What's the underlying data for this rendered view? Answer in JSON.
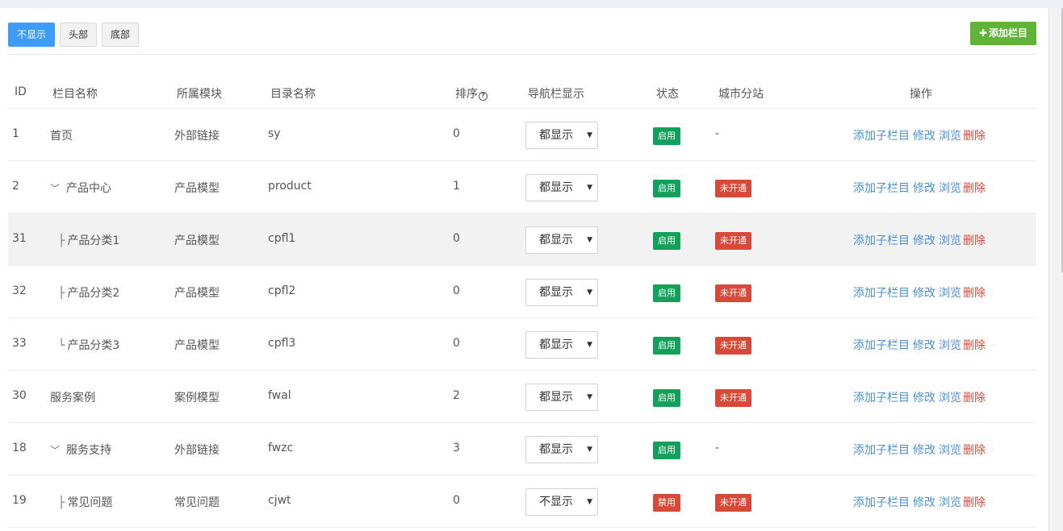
{
  "toolbar": {
    "tabs": [
      {
        "label": "不显示",
        "active": true
      },
      {
        "label": "头部",
        "active": false
      },
      {
        "label": "底部",
        "active": false
      }
    ],
    "add_label": "添加栏目"
  },
  "table": {
    "headers": {
      "id": "ID",
      "name": "栏目名称",
      "module": "所属模块",
      "dir": "目录名称",
      "sort": "排序",
      "nav": "导航栏显示",
      "status": "状态",
      "city": "城市分站",
      "ops": "操作"
    },
    "ops": {
      "add_child": "添加子栏目",
      "edit": "修改",
      "view": "浏览",
      "delete": "删除"
    },
    "rows": [
      {
        "id": "1",
        "name": "首页",
        "level": 0,
        "expandable": false,
        "tree": "",
        "module": "外部链接",
        "dir": "sy",
        "sort": "0",
        "nav": "都显示",
        "status": "启用",
        "status_color": "#13a05b",
        "city": "-"
      },
      {
        "id": "2",
        "name": "产品中心",
        "level": 0,
        "expandable": true,
        "tree": "",
        "module": "产品模型",
        "dir": "product",
        "sort": "1",
        "nav": "都显示",
        "status": "启用",
        "status_color": "#13a05b",
        "city": "未开通"
      },
      {
        "id": "31",
        "name": "产品分类1",
        "level": 1,
        "expandable": false,
        "tree": "├",
        "module": "产品模型",
        "dir": "cpfl1",
        "sort": "0",
        "nav": "都显示",
        "status": "启用",
        "status_color": "#13a05b",
        "city": "未开通"
      },
      {
        "id": "32",
        "name": "产品分类2",
        "level": 1,
        "expandable": false,
        "tree": "├",
        "module": "产品模型",
        "dir": "cpfl2",
        "sort": "0",
        "nav": "都显示",
        "status": "启用",
        "status_color": "#13a05b",
        "city": "未开通"
      },
      {
        "id": "33",
        "name": "产品分类3",
        "level": 1,
        "expandable": false,
        "tree": "└",
        "module": "产品模型",
        "dir": "cpfl3",
        "sort": "0",
        "nav": "都显示",
        "status": "启用",
        "status_color": "#13a05b",
        "city": "未开通"
      },
      {
        "id": "30",
        "name": "服务案例",
        "level": 0,
        "expandable": false,
        "tree": "",
        "module": "案例模型",
        "dir": "fwal",
        "sort": "2",
        "nav": "都显示",
        "status": "启用",
        "status_color": "#13a05b",
        "city": "未开通"
      },
      {
        "id": "18",
        "name": "服务支持",
        "level": 0,
        "expandable": true,
        "tree": "",
        "module": "外部链接",
        "dir": "fwzc",
        "sort": "3",
        "nav": "都显示",
        "status": "启用",
        "status_color": "#13a05b",
        "city": "-"
      },
      {
        "id": "19",
        "name": "常见问题",
        "level": 1,
        "expandable": false,
        "tree": "├",
        "module": "常见问题",
        "dir": "cjwt",
        "sort": "0",
        "nav": "不显示",
        "status": "禁用",
        "status_color": "#d9493a",
        "city": "未开通"
      }
    ]
  },
  "colors": {
    "accent": "#3e9bf7",
    "add_button": "#5fb336",
    "enabled": "#13a05b",
    "disabled": "#d9493a",
    "link": "#4a90d0"
  }
}
